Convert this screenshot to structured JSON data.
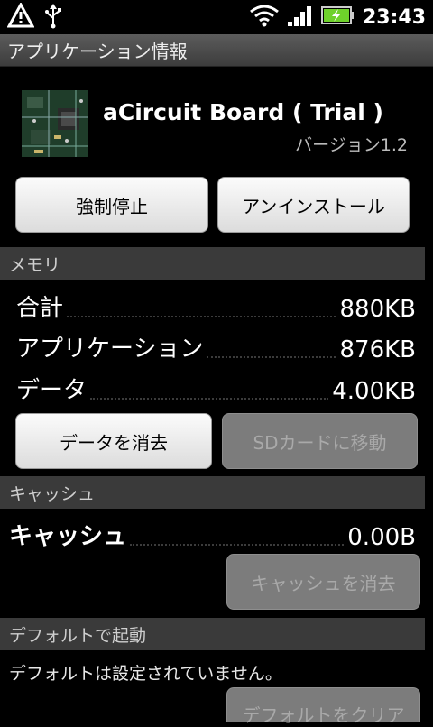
{
  "status_bar": {
    "time": "23:43",
    "icons": [
      "warning-icon",
      "usb-icon",
      "wifi-icon",
      "signal-icon",
      "battery-charging-icon"
    ]
  },
  "title_bar": {
    "title": "アプリケーション情報"
  },
  "app": {
    "name": "aCircuit Board ( Trial )",
    "version": "バージョン1.2",
    "icon": "circuit-board-app-icon"
  },
  "actions": {
    "force_stop": "強制停止",
    "uninstall": "アンインストール"
  },
  "memory": {
    "header": "メモリ",
    "rows": [
      {
        "label": "合計",
        "value": "880KB"
      },
      {
        "label": "アプリケーション",
        "value": "876KB"
      },
      {
        "label": "データ",
        "value": "4.00KB"
      }
    ],
    "clear_data": "データを消去",
    "move_to_sd": "SDカードに移動"
  },
  "cache": {
    "header": "キャッシュ",
    "label": "キャッシュ",
    "value": "0.00B",
    "clear_cache": "キャッシュを消去"
  },
  "defaults": {
    "header": "デフォルトで起動",
    "text": "デフォルトは設定されていません。",
    "clear_defaults": "デフォルトをクリア"
  },
  "colors": {
    "section_bg": "#3a3a3a",
    "button_enabled": "#f0f0f0",
    "button_disabled": "#7c7c7c",
    "battery_green": "#6fd12b"
  }
}
